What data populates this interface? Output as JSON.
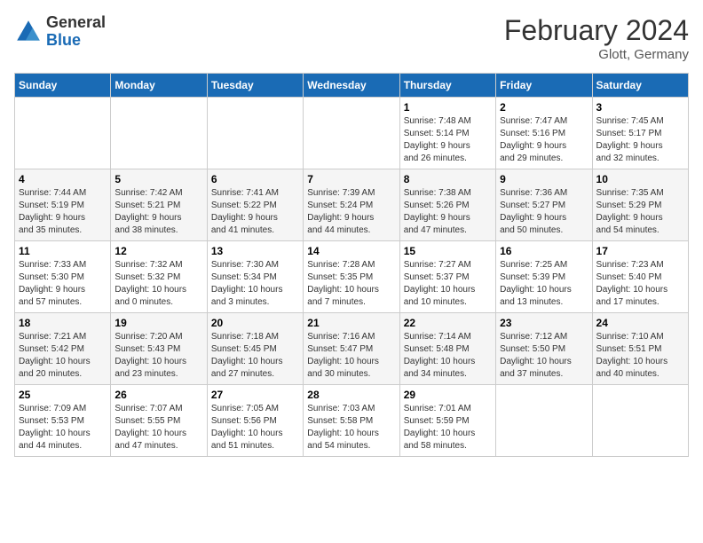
{
  "logo": {
    "general": "General",
    "blue": "Blue"
  },
  "title": "February 2024",
  "subtitle": "Glott, Germany",
  "days_header": [
    "Sunday",
    "Monday",
    "Tuesday",
    "Wednesday",
    "Thursday",
    "Friday",
    "Saturday"
  ],
  "weeks": [
    [
      {
        "day": "",
        "info": ""
      },
      {
        "day": "",
        "info": ""
      },
      {
        "day": "",
        "info": ""
      },
      {
        "day": "",
        "info": ""
      },
      {
        "day": "1",
        "info": "Sunrise: 7:48 AM\nSunset: 5:14 PM\nDaylight: 9 hours\nand 26 minutes."
      },
      {
        "day": "2",
        "info": "Sunrise: 7:47 AM\nSunset: 5:16 PM\nDaylight: 9 hours\nand 29 minutes."
      },
      {
        "day": "3",
        "info": "Sunrise: 7:45 AM\nSunset: 5:17 PM\nDaylight: 9 hours\nand 32 minutes."
      }
    ],
    [
      {
        "day": "4",
        "info": "Sunrise: 7:44 AM\nSunset: 5:19 PM\nDaylight: 9 hours\nand 35 minutes."
      },
      {
        "day": "5",
        "info": "Sunrise: 7:42 AM\nSunset: 5:21 PM\nDaylight: 9 hours\nand 38 minutes."
      },
      {
        "day": "6",
        "info": "Sunrise: 7:41 AM\nSunset: 5:22 PM\nDaylight: 9 hours\nand 41 minutes."
      },
      {
        "day": "7",
        "info": "Sunrise: 7:39 AM\nSunset: 5:24 PM\nDaylight: 9 hours\nand 44 minutes."
      },
      {
        "day": "8",
        "info": "Sunrise: 7:38 AM\nSunset: 5:26 PM\nDaylight: 9 hours\nand 47 minutes."
      },
      {
        "day": "9",
        "info": "Sunrise: 7:36 AM\nSunset: 5:27 PM\nDaylight: 9 hours\nand 50 minutes."
      },
      {
        "day": "10",
        "info": "Sunrise: 7:35 AM\nSunset: 5:29 PM\nDaylight: 9 hours\nand 54 minutes."
      }
    ],
    [
      {
        "day": "11",
        "info": "Sunrise: 7:33 AM\nSunset: 5:30 PM\nDaylight: 9 hours\nand 57 minutes."
      },
      {
        "day": "12",
        "info": "Sunrise: 7:32 AM\nSunset: 5:32 PM\nDaylight: 10 hours\nand 0 minutes."
      },
      {
        "day": "13",
        "info": "Sunrise: 7:30 AM\nSunset: 5:34 PM\nDaylight: 10 hours\nand 3 minutes."
      },
      {
        "day": "14",
        "info": "Sunrise: 7:28 AM\nSunset: 5:35 PM\nDaylight: 10 hours\nand 7 minutes."
      },
      {
        "day": "15",
        "info": "Sunrise: 7:27 AM\nSunset: 5:37 PM\nDaylight: 10 hours\nand 10 minutes."
      },
      {
        "day": "16",
        "info": "Sunrise: 7:25 AM\nSunset: 5:39 PM\nDaylight: 10 hours\nand 13 minutes."
      },
      {
        "day": "17",
        "info": "Sunrise: 7:23 AM\nSunset: 5:40 PM\nDaylight: 10 hours\nand 17 minutes."
      }
    ],
    [
      {
        "day": "18",
        "info": "Sunrise: 7:21 AM\nSunset: 5:42 PM\nDaylight: 10 hours\nand 20 minutes."
      },
      {
        "day": "19",
        "info": "Sunrise: 7:20 AM\nSunset: 5:43 PM\nDaylight: 10 hours\nand 23 minutes."
      },
      {
        "day": "20",
        "info": "Sunrise: 7:18 AM\nSunset: 5:45 PM\nDaylight: 10 hours\nand 27 minutes."
      },
      {
        "day": "21",
        "info": "Sunrise: 7:16 AM\nSunset: 5:47 PM\nDaylight: 10 hours\nand 30 minutes."
      },
      {
        "day": "22",
        "info": "Sunrise: 7:14 AM\nSunset: 5:48 PM\nDaylight: 10 hours\nand 34 minutes."
      },
      {
        "day": "23",
        "info": "Sunrise: 7:12 AM\nSunset: 5:50 PM\nDaylight: 10 hours\nand 37 minutes."
      },
      {
        "day": "24",
        "info": "Sunrise: 7:10 AM\nSunset: 5:51 PM\nDaylight: 10 hours\nand 40 minutes."
      }
    ],
    [
      {
        "day": "25",
        "info": "Sunrise: 7:09 AM\nSunset: 5:53 PM\nDaylight: 10 hours\nand 44 minutes."
      },
      {
        "day": "26",
        "info": "Sunrise: 7:07 AM\nSunset: 5:55 PM\nDaylight: 10 hours\nand 47 minutes."
      },
      {
        "day": "27",
        "info": "Sunrise: 7:05 AM\nSunset: 5:56 PM\nDaylight: 10 hours\nand 51 minutes."
      },
      {
        "day": "28",
        "info": "Sunrise: 7:03 AM\nSunset: 5:58 PM\nDaylight: 10 hours\nand 54 minutes."
      },
      {
        "day": "29",
        "info": "Sunrise: 7:01 AM\nSunset: 5:59 PM\nDaylight: 10 hours\nand 58 minutes."
      },
      {
        "day": "",
        "info": ""
      },
      {
        "day": "",
        "info": ""
      }
    ]
  ]
}
